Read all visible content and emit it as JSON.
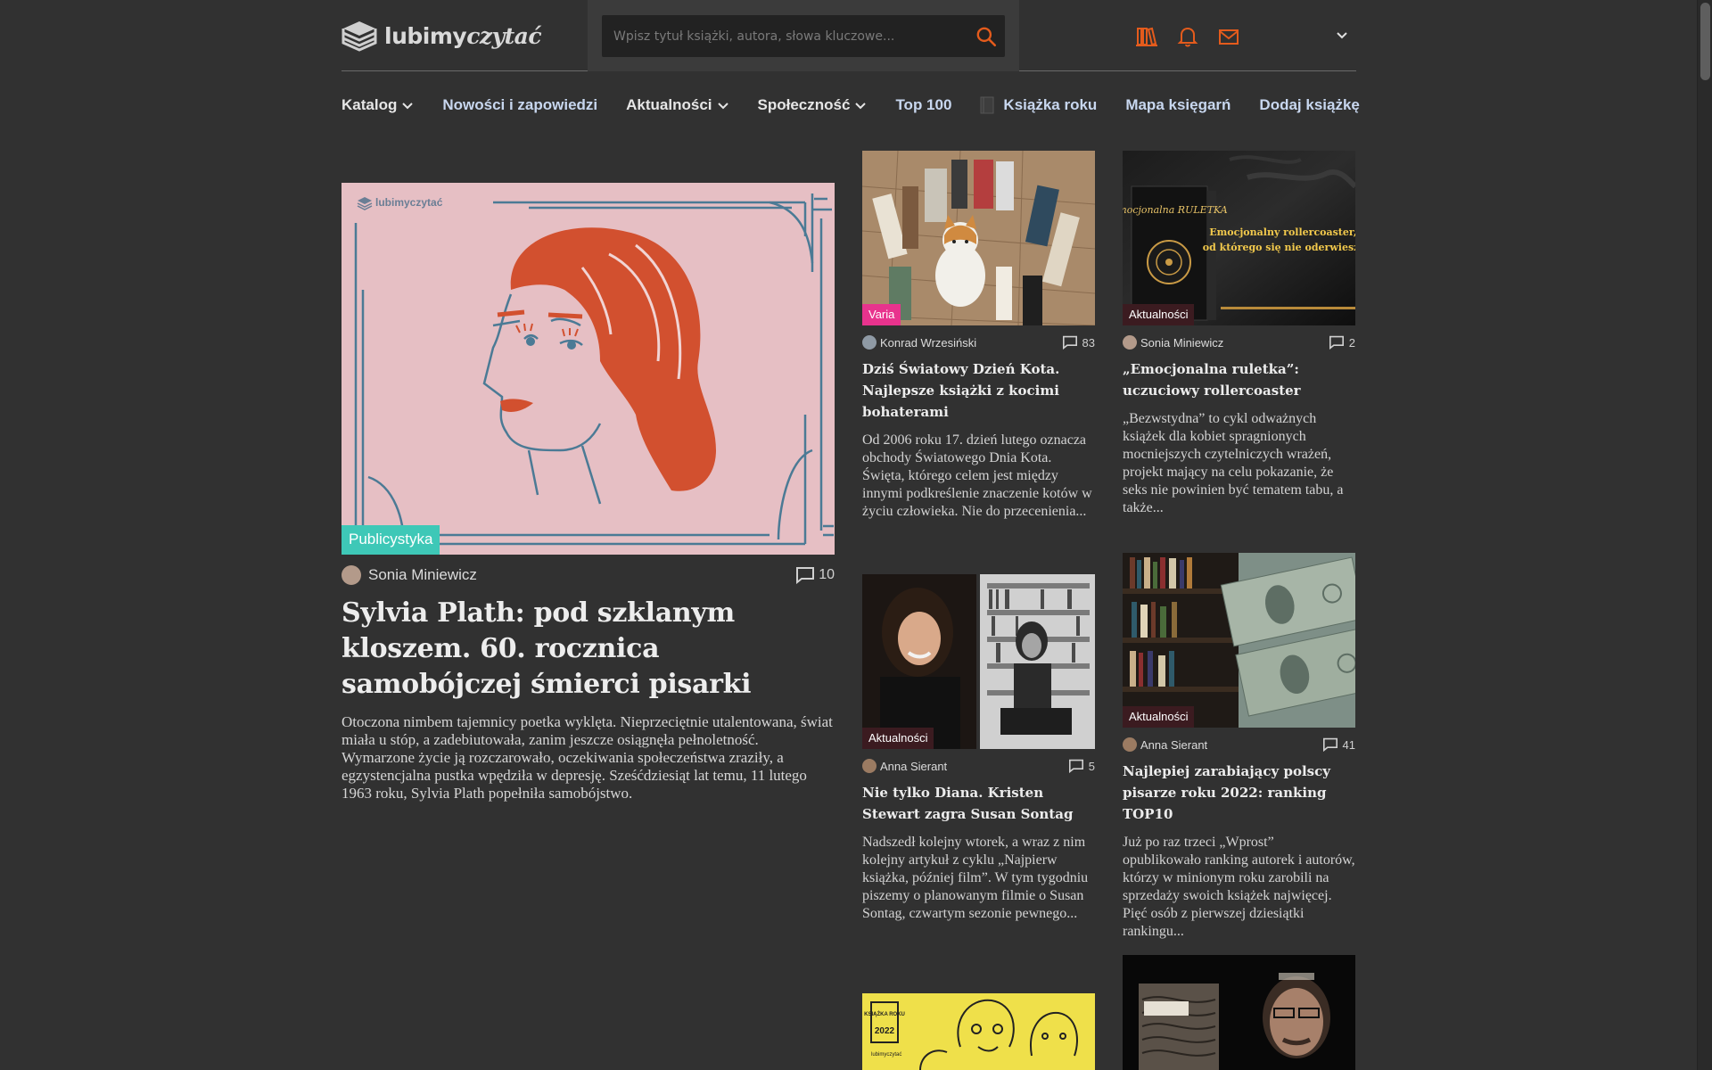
{
  "logo": {
    "part1": "lubimy",
    "part2": "czytać"
  },
  "search": {
    "placeholder": "Wpisz tytuł książki, autora, słowa kluczowe..."
  },
  "icons": {
    "shelf": "bookshelf-icon",
    "notifications": "bell-icon",
    "messages": "envelope-icon",
    "accent": "#e45b1c"
  },
  "nav": [
    {
      "label": "Katalog"
    },
    {
      "label": "Nowości i zapowiedzi"
    },
    {
      "label": "Aktualności"
    },
    {
      "label": "Społeczność"
    },
    {
      "label": "Top 100"
    },
    {
      "label": "Książka roku"
    },
    {
      "label": "Mapa księgarń"
    },
    {
      "label": "Dodaj książkę"
    }
  ],
  "featured": {
    "category": "Publicystyka",
    "category_color": "#3ec8b7",
    "image_logo": "lubimyczytać",
    "author": "Sonia Miniewicz",
    "comments": "10",
    "title": "Sylvia Plath: pod szklanym kloszem. 60. rocznica samobójczej śmierci pisarki",
    "excerpt": "Otoczona nimbem tajemnicy poetka wyklęta. Nieprzeciętnie utalentowana, świat miała u stóp, a zadebiutowała, zanim jeszcze osiągnęła pełnoletność. Wymarzone życie ją rozczarowało, oczekiwania społeczeństwa zraziły, a egzystencjalna pustka wpędziła w depresję. Sześćdziesiąt lat temu, 11 lutego 1963 roku, Sylvia Plath popełniła samobójstwo."
  },
  "articles": [
    {
      "category": "Varia",
      "author": "Konrad Wrzesiński",
      "comments": "83",
      "title": "Dziś Światowy Dzień Kota. Najlepsze książki z kocimi bohaterami",
      "excerpt": "Od 2006 roku 17. dzień lutego oznacza obchody Światowego Dnia Kota. Święta, którego celem jest między innymi podkreślenie znaczenie kotów w życiu człowieka. Nie do przecenienia..."
    },
    {
      "category": "Aktualności",
      "author": "Sonia Miniewicz",
      "comments": "2",
      "title": "„Emocjonalna ruletka”: uczuciowy rollercoaster",
      "excerpt": "„Bezwstydna” to cykl odważnych książek dla kobiet spragnionych mocniejszych czytelniczych wrażeń, projekt mający na celu pokazanie, że seks nie powinien być tematem tabu, a także...",
      "image_text": {
        "book": "Emocjonalna RULETKA",
        "tagline_1": "Emocjonalny rollercoaster,",
        "tagline_2": "od którego się nie oderwiesz!"
      }
    },
    {
      "category": "Aktualności",
      "author": "Anna Sierant",
      "comments": "5",
      "title": "Nie tylko Diana. Kristen Stewart zagra Susan Sontag",
      "excerpt": "Nadszedł kolejny wtorek, a wraz z nim kolejny artykuł z cyklu „Najpierw książka, później film”. W tym tygodniu piszemy o planowanym filmie o Susan Sontag, czwartym sezonie pewnego..."
    },
    {
      "category": "Aktualności",
      "author": "Anna Sierant",
      "comments": "41",
      "title": "Najlepiej zarabiający polscy pisarze roku 2022: ranking TOP10",
      "excerpt": "Już po raz trzeci „Wprost” opublikowało ranking autorek i autorów, którzy w minionym roku zarobili na sprzedaży swoich książek najwięcej. Pięć osób z pierwszej dziesiątki rankingu..."
    }
  ],
  "teaser_left": {
    "badge_top": "KSIĄŻKA ROKU",
    "badge_year": "2022",
    "brand": "lubimyczytać"
  },
  "colors": {
    "background": "#313131",
    "link": "#c8d7ef",
    "badge_teal": "#3ec8b7",
    "badge_pink": "#e8338d",
    "search_bg": "#222222"
  }
}
